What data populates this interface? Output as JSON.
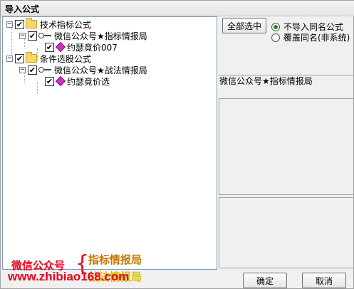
{
  "window": {
    "title": "导入公式"
  },
  "tree": {
    "groups": [
      {
        "label": "技术指标公式",
        "expander": "−",
        "checked": "✔",
        "child": {
          "label": "微信公众号★指标情报局",
          "expander": "−",
          "checked": "✔",
          "leaf": {
            "label": "约瑟竟价007",
            "checked": "✔"
          }
        }
      },
      {
        "label": "条件选股公式",
        "expander": "−",
        "checked": "✔",
        "child": {
          "label": "微信公众号★战法情报局",
          "expander": "−",
          "checked": "✔",
          "leaf": {
            "label": "约瑟竟价选",
            "checked": "✔"
          }
        }
      }
    ]
  },
  "watermark": {
    "left": "微信公众号",
    "brace": "{",
    "right_top": "指标情报局",
    "right_bottom": "战法情报局",
    "url": "www.zhibiao168.com"
  },
  "controls": {
    "select_all": "全部选中",
    "radio_skip": "不导入同名公式",
    "radio_overwrite": "覆盖同名(非系统)",
    "selected_name": "微信公众号★指标情报局",
    "ok": "确定",
    "cancel": "取消"
  },
  "colors": {
    "radio_selected": "#1a8a1a",
    "promo_red": "#e8001c",
    "promo_orange": "#c87800",
    "promo_yellow": "#d8c000"
  }
}
